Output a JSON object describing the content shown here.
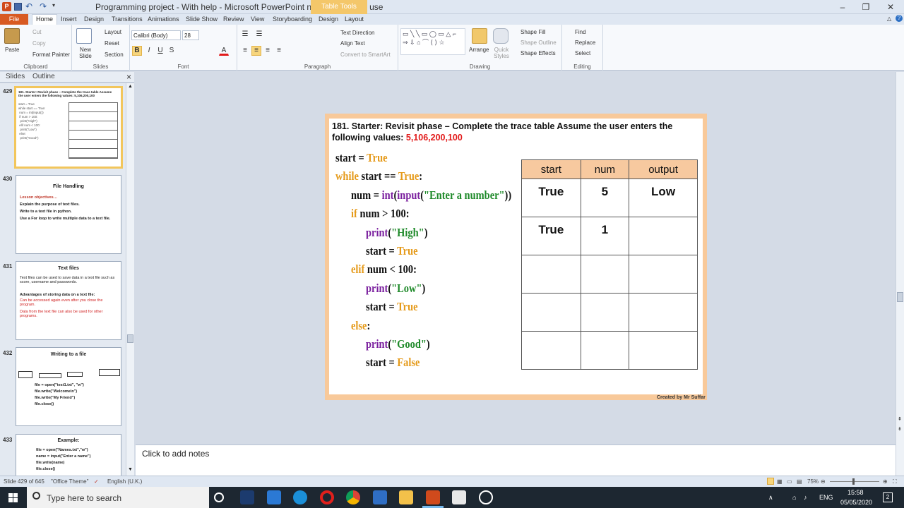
{
  "window": {
    "title": "Programming project - With help - Microsoft PowerPoint non-commercial use",
    "context_group": "Table Tools"
  },
  "tabs": [
    "File",
    "Home",
    "Insert",
    "Design",
    "Transitions",
    "Animations",
    "Slide Show",
    "Review",
    "View",
    "Storyboarding",
    "Design",
    "Layout"
  ],
  "ribbon": {
    "clipboard": {
      "label": "Clipboard",
      "paste": "Paste",
      "cut": "Cut",
      "copy": "Copy",
      "format_painter": "Format Painter"
    },
    "slides": {
      "label": "Slides",
      "new_slide": "New Slide",
      "layout": "Layout",
      "reset": "Reset",
      "section": "Section"
    },
    "font": {
      "label": "Font",
      "family": "Calibri (Body)",
      "size": "28"
    },
    "paragraph": {
      "label": "Paragraph",
      "text_direction": "Text Direction",
      "align_text": "Align Text",
      "convert_smartart": "Convert to SmartArt"
    },
    "drawing": {
      "label": "Drawing",
      "arrange": "Arrange",
      "quick_styles": "Quick Styles",
      "shape_fill": "Shape Fill",
      "shape_outline": "Shape Outline",
      "shape_effects": "Shape Effects"
    },
    "editing": {
      "label": "Editing",
      "find": "Find",
      "replace": "Replace",
      "select": "Select"
    }
  },
  "panel": {
    "tab_slides": "Slides",
    "tab_outline": "Outline",
    "close": "×"
  },
  "thumbnails": [
    {
      "num": "429",
      "title": "181. Starter: Revisit phase – Complete the trace table Assume the user enters the following values: 5,106,200,100"
    },
    {
      "num": "430",
      "title": "File Handling",
      "objectives_label": "Lesson objectives…",
      "lines": [
        "Explain the purpose of text files.",
        "Write to a text file in python.",
        "Use a For loop to write multiple data to a text file."
      ]
    },
    {
      "num": "431",
      "title": "Text files",
      "lines": [
        "Text files can be used to save data in a text file such as score, username and passwords.",
        "Advantages of storing data on a text file:",
        "Can be accessed again even after you close the program.",
        "Data from the text file can also be used for other programs."
      ]
    },
    {
      "num": "432",
      "title": "Writing to a file",
      "lines": [
        "file = open(\"test1.txt\", \"w\")",
        "file.write(\"Welcome\\n\")",
        "file.write(\"My Friend\")",
        "file.close()"
      ]
    },
    {
      "num": "433",
      "title": "Example:",
      "lines": [
        "file = open(\"Names.txt\",\"w\")",
        "name = input(\"Enter a name\")",
        "file.write(name)",
        "file.close()"
      ]
    }
  ],
  "slide": {
    "title_black": "181. Starter: Revisit phase – Complete the trace table Assume the user enters the following values: ",
    "title_red": "5,106,200,100",
    "credit": "Created by Mr Suffar",
    "code": [
      {
        "indent": 0,
        "parts": [
          [
            "start = ",
            ""
          ],
          [
            "True",
            "tv"
          ]
        ]
      },
      {
        "indent": 0,
        "parts": [
          [
            "while",
            "kw"
          ],
          [
            " start == ",
            ""
          ],
          [
            "True",
            "tv"
          ],
          [
            ":",
            ""
          ]
        ]
      },
      {
        "indent": 1,
        "parts": [
          [
            "num = ",
            ""
          ],
          [
            "int",
            "fn"
          ],
          [
            "(",
            ""
          ],
          [
            "input",
            "fn"
          ],
          [
            "(",
            ""
          ],
          [
            "\"Enter a number\"",
            "str"
          ],
          [
            "))",
            ""
          ]
        ]
      },
      {
        "indent": 1,
        "parts": [
          [
            "if",
            "kw"
          ],
          [
            " num > 100:",
            ""
          ]
        ]
      },
      {
        "indent": 2,
        "parts": [
          [
            "print",
            "fn"
          ],
          [
            "(",
            ""
          ],
          [
            "\"High\"",
            "str"
          ],
          [
            ")",
            ""
          ]
        ]
      },
      {
        "indent": 2,
        "parts": [
          [
            "start = ",
            ""
          ],
          [
            "True",
            "tv"
          ]
        ]
      },
      {
        "indent": 1,
        "parts": [
          [
            "elif",
            "kw"
          ],
          [
            " num < 100:",
            ""
          ]
        ]
      },
      {
        "indent": 2,
        "parts": [
          [
            "print",
            "fn"
          ],
          [
            "(",
            ""
          ],
          [
            "\"Low\"",
            "str"
          ],
          [
            ")",
            ""
          ]
        ]
      },
      {
        "indent": 2,
        "parts": [
          [
            "start = ",
            ""
          ],
          [
            "True",
            "tv"
          ]
        ]
      },
      {
        "indent": 1,
        "parts": [
          [
            "else",
            "kw"
          ],
          [
            ":",
            ""
          ]
        ]
      },
      {
        "indent": 2,
        "parts": [
          [
            "print",
            "fn"
          ],
          [
            "(",
            ""
          ],
          [
            "\"Good\"",
            "str"
          ],
          [
            ")",
            ""
          ]
        ]
      },
      {
        "indent": 2,
        "parts": [
          [
            "start = ",
            ""
          ],
          [
            "False",
            "tv"
          ]
        ]
      }
    ],
    "trace_table": {
      "headers": [
        "start",
        "num",
        "output"
      ],
      "rows": [
        [
          "True",
          "5",
          "Low"
        ],
        [
          "True",
          "1",
          ""
        ],
        [
          "",
          "",
          ""
        ],
        [
          "",
          "",
          ""
        ],
        [
          "",
          "",
          ""
        ]
      ]
    }
  },
  "notes": {
    "placeholder": "Click to add notes"
  },
  "statusbar": {
    "slide_pos": "Slide 429 of 645",
    "theme": "\"Office Theme\"",
    "language": "English (U.K.)",
    "zoom": "75%"
  },
  "taskbar": {
    "search_placeholder": "Type here to search",
    "lang": "ENG",
    "time": "15:58",
    "date": "05/05/2020",
    "notif_count": "2"
  },
  "colors": {
    "file_tab": "#d85a22",
    "slide_border": "#f8c99a",
    "table_header": "#f7c99f",
    "accent_red": "#e21a1a"
  }
}
